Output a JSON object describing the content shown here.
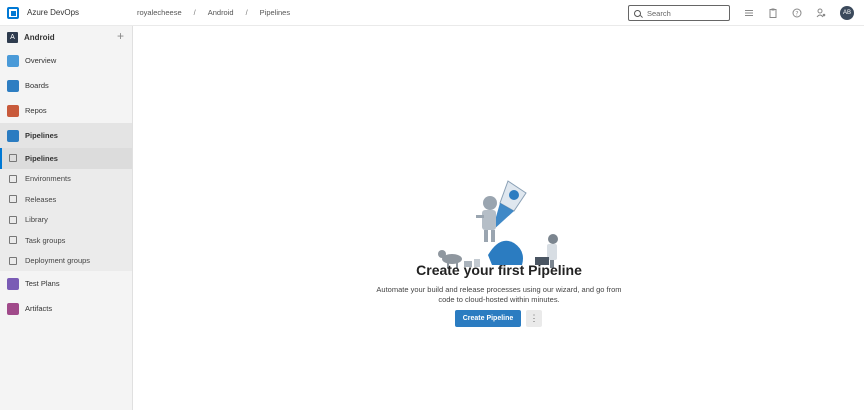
{
  "app": {
    "brand": "Azure DevOps"
  },
  "breadcrumb": [
    "royalecheese",
    "Android",
    "Pipelines"
  ],
  "breadcrumb_sep": "/",
  "search": {
    "placeholder": "Search"
  },
  "header_icons": [
    "list-settings-icon",
    "clipboard-icon",
    "help-icon",
    "user-settings-icon"
  ],
  "user": {
    "initials": "AB"
  },
  "project": {
    "badge": "A",
    "name": "Android",
    "add_label": "+"
  },
  "sidebar": {
    "items": [
      {
        "label": "Overview",
        "icon": "overview-icon",
        "color": "#4a9ad8"
      },
      {
        "label": "Boards",
        "icon": "boards-icon",
        "color": "#2e7ec2"
      },
      {
        "label": "Repos",
        "icon": "repos-icon",
        "color": "#c85a3b"
      },
      {
        "label": "Pipelines",
        "icon": "pipelines-icon",
        "color": "#2b7cc1",
        "selected": true
      },
      {
        "label": "Test Plans",
        "icon": "test-plans-icon",
        "color": "#7a5bb5"
      },
      {
        "label": "Artifacts",
        "icon": "artifacts-icon",
        "color": "#a04a8a"
      }
    ],
    "pipelines_sub": [
      {
        "label": "Pipelines",
        "icon": "pipelines-sub-icon",
        "active": true
      },
      {
        "label": "Environments",
        "icon": "environments-icon"
      },
      {
        "label": "Releases",
        "icon": "releases-icon"
      },
      {
        "label": "Library",
        "icon": "library-icon"
      },
      {
        "label": "Task groups",
        "icon": "task-groups-icon"
      },
      {
        "label": "Deployment groups",
        "icon": "deployment-groups-icon"
      }
    ]
  },
  "empty_state": {
    "title": "Create your first Pipeline",
    "description": "Automate your build and release processes using our wizard, and go from code to cloud-hosted within minutes.",
    "primary_button": "Create Pipeline",
    "more_button": "⋮"
  },
  "colors": {
    "accent": "#0078d4",
    "button": "#2b7cc1"
  }
}
